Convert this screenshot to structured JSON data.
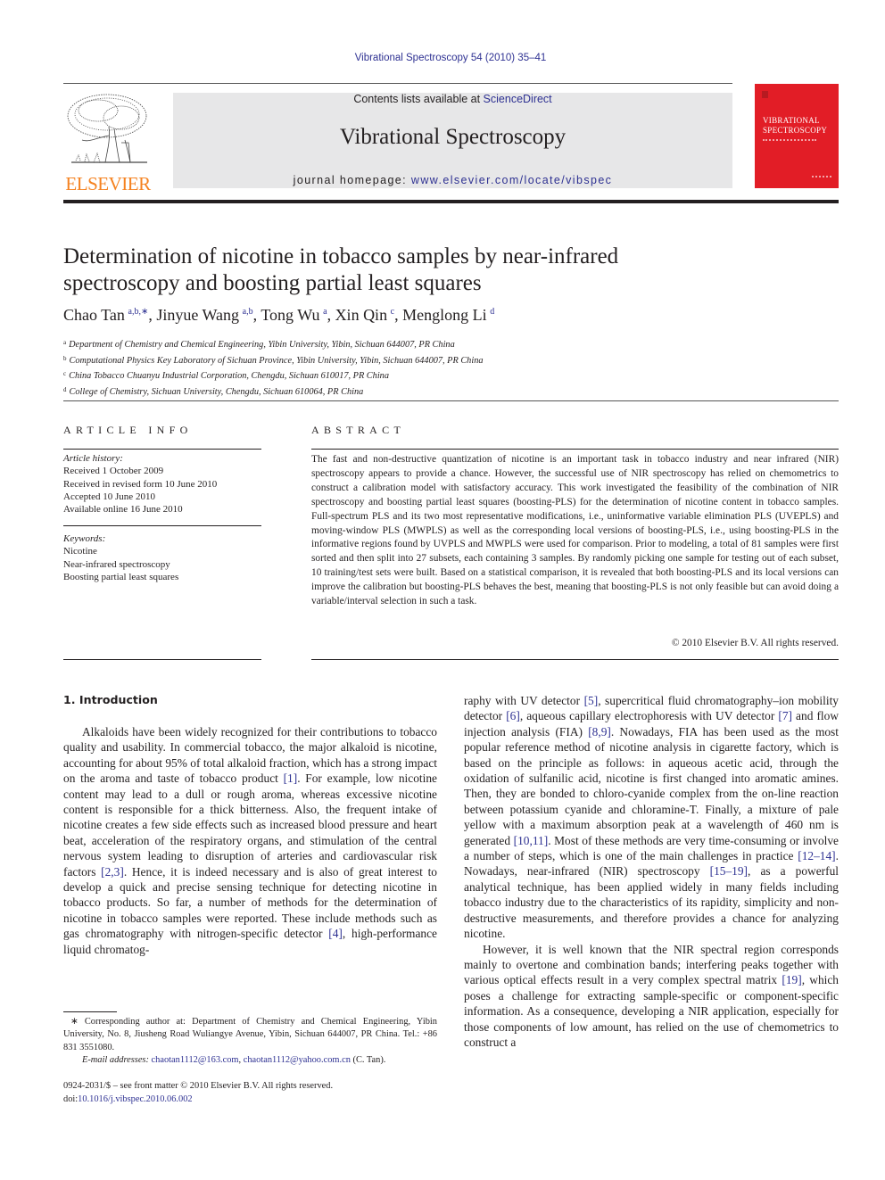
{
  "running_head": "Vibrational Spectroscopy 54 (2010) 35–41",
  "masthead": {
    "contents_prefix": "Contents lists available at ",
    "contents_link": "ScienceDirect",
    "journal_name": "Vibrational Spectroscopy",
    "homepage_prefix": "journal homepage: ",
    "homepage_link": "www.elsevier.com/locate/vibspec",
    "publisher_wordmark": "ELSEVIER",
    "cover_title_line1": "VIBRATIONAL",
    "cover_title_line2": "SPECTROSCOPY",
    "colors": {
      "publisher_orange": "#f58220",
      "cover_red": "#e21d26",
      "link_blue": "#2e3192",
      "masthead_gray": "#e7e7e8"
    }
  },
  "article": {
    "title": "Determination of nicotine in tobacco samples by near-infrared spectroscopy and boosting partial least squares",
    "authors": [
      {
        "name": "Chao Tan",
        "sup": "a,b,∗"
      },
      {
        "name": "Jinyue Wang",
        "sup": "a,b"
      },
      {
        "name": "Tong Wu",
        "sup": "a"
      },
      {
        "name": "Xin Qin",
        "sup": "c"
      },
      {
        "name": "Menglong Li",
        "sup": "d"
      }
    ],
    "affiliations": [
      {
        "mark": "a",
        "text": "Department of Chemistry and Chemical Engineering, Yibin University, Yibin, Sichuan 644007, PR China"
      },
      {
        "mark": "b",
        "text": "Computational Physics Key Laboratory of Sichuan Province, Yibin University, Yibin, Sichuan 644007, PR China"
      },
      {
        "mark": "c",
        "text": "China Tobacco Chuanyu Industrial Corporation, Chengdu, Sichuan 610017, PR China"
      },
      {
        "mark": "d",
        "text": "College of Chemistry, Sichuan University, Chengdu, Sichuan 610064, PR China"
      }
    ]
  },
  "article_info": {
    "heading": "ARTICLE INFO",
    "history_label": "Article history:",
    "history": [
      "Received 1 October 2009",
      "Received in revised form 10 June 2010",
      "Accepted 10 June 2010",
      "Available online 16 June 2010"
    ],
    "keywords_label": "Keywords:",
    "keywords": [
      "Nicotine",
      "Near-infrared spectroscopy",
      "Boosting partial least squares"
    ]
  },
  "abstract": {
    "heading": "ABSTRACT",
    "text": "The fast and non-destructive quantization of nicotine is an important task in tobacco industry and near infrared (NIR) spectroscopy appears to provide a chance. However, the successful use of NIR spectroscopy has relied on chemometrics to construct a calibration model with satisfactory accuracy. This work investigated the feasibility of the combination of NIR spectroscopy and boosting partial least squares (boosting-PLS) for the determination of nicotine content in tobacco samples. Full-spectrum PLS and its two most representative modifications, i.e., uninformative variable elimination PLS (UVEPLS) and moving-window PLS (MWPLS) as well as the corresponding local versions of boosting-PLS, i.e., using boosting-PLS in the informative regions found by UVPLS and MWPLS were used for comparison. Prior to modeling, a total of 81 samples were first sorted and then split into 27 subsets, each containing 3 samples. By randomly picking one sample for testing out of each subset, 10 training/test sets were built. Based on a statistical comparison, it is revealed that both boosting-PLS and its local versions can improve the calibration but boosting-PLS behaves the best, meaning that boosting-PLS is not only feasible but can avoid doing a variable/interval selection in such a task.",
    "copyright": "© 2010 Elsevier B.V. All rights reserved."
  },
  "body": {
    "section_heading": "1.  Introduction",
    "left_para": [
      {
        "t": "Alkaloids have been widely recognized for their contributions to tobacco quality and usability. In commercial tobacco, the major alkaloid is nicotine, accounting for about 95% of total alkaloid fraction, which has a strong impact on the aroma and taste of tobacco product "
      },
      {
        "ref": "[1]"
      },
      {
        "t": ". For example, low nicotine content may lead to a dull or rough aroma, whereas excessive nicotine content is responsible for a thick bitterness. Also, the frequent intake of nicotine creates a few side effects such as increased blood pressure and heart beat, acceleration of the respiratory organs, and stimulation of the central nervous system leading to disruption of arteries and cardiovascular risk factors "
      },
      {
        "ref": "[2,3]"
      },
      {
        "t": ". Hence, it is indeed necessary and is also of great interest to develop a quick and precise sensing technique for detecting nicotine in tobacco products. So far, a number of methods for the determination of nicotine in tobacco samples were reported. These include methods such as gas chromatography with nitrogen-specific detector "
      },
      {
        "ref": "[4]"
      },
      {
        "t": ", high-performance liquid chromatog-"
      }
    ],
    "right_para1": [
      {
        "t": "raphy with UV detector "
      },
      {
        "ref": "[5]"
      },
      {
        "t": ", supercritical fluid chromatography–ion mobility detector "
      },
      {
        "ref": "[6]"
      },
      {
        "t": ", aqueous capillary electrophoresis with UV detector "
      },
      {
        "ref": "[7]"
      },
      {
        "t": " and flow injection analysis (FIA) "
      },
      {
        "ref": "[8,9]"
      },
      {
        "t": ". Nowadays, FIA has been used as the most popular reference method of nicotine analysis in cigarette factory, which is based on the principle as follows: in aqueous acetic acid, through the oxidation of sulfanilic acid, nicotine is first changed into aromatic amines. Then, they are bonded to chloro-cyanide complex from the on-line reaction between potassium cyanide and chloramine-T. Finally, a mixture of pale yellow with a maximum absorption peak at a wavelength of 460 nm is generated "
      },
      {
        "ref": "[10,11]"
      },
      {
        "t": ". Most of these methods are very time-consuming or involve a number of steps, which is one of the main challenges in practice "
      },
      {
        "ref": "[12–14]"
      },
      {
        "t": ". Nowadays, near-infrared (NIR) spectroscopy "
      },
      {
        "ref": "[15–19]"
      },
      {
        "t": ", as a powerful analytical technique, has been applied widely in many fields including tobacco industry due to the characteristics of its rapidity, simplicity and non-destructive measurements, and therefore provides a chance for analyzing nicotine."
      }
    ],
    "right_para2": [
      {
        "t": "However, it is well known that the NIR spectral region corresponds mainly to overtone and combination bands; interfering peaks together with various optical effects result in a very complex spectral matrix "
      },
      {
        "ref": "[19]"
      },
      {
        "t": ", which poses a challenge for extracting sample-specific or component-specific information. As a consequence, developing a NIR application, especially for those components of low amount, has relied on the use of chemometrics to construct a"
      }
    ]
  },
  "footnote": {
    "corresponding": "∗  Corresponding author at: Department of Chemistry and Chemical Engineering, Yibin University, No. 8, Jiusheng Road Wuliangye Avenue, Yibin, Sichuan 644007, PR China. Tel.: +86 831 3551080.",
    "email_label": "E-mail addresses:",
    "email1": "chaotan1112@163.com",
    "email2": "chaotan1112@yahoo.com.cn",
    "email_suffix": " (C. Tan)."
  },
  "front_matter": {
    "issn_line": "0924-2031/$ – see front matter © 2010 Elsevier B.V. All rights reserved.",
    "doi_prefix": "doi:",
    "doi": "10.1016/j.vibspec.2010.06.002"
  }
}
